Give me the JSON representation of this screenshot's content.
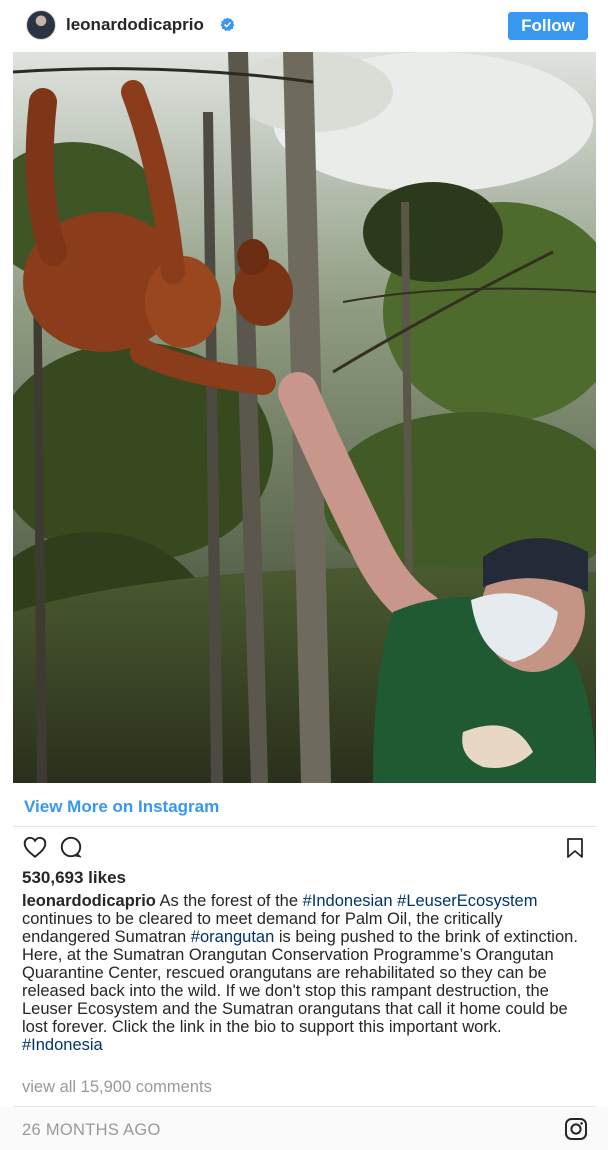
{
  "header": {
    "username": "leonardodicaprio",
    "follow_label": "Follow"
  },
  "photo": {
    "description_icon": "photo-orangutan-forest"
  },
  "view_more_label": "View More on Instagram",
  "actions": {
    "like_icon": "heart-icon",
    "comment_icon": "comment-icon",
    "save_icon": "bookmark-icon"
  },
  "likes": "530,693 likes",
  "caption": {
    "username": "leonardodicaprio",
    "seg1": " As the forest of the ",
    "tag1": "#Indonesian",
    "seg2": " ",
    "tag2": "#LeuserEcosystem",
    "seg3": " continues to be cleared to meet demand for Palm Oil, the critically endangered Sumatran ",
    "tag3": "#orangutan",
    "seg4": " is being pushed to the brink of extinction. Here, at the Sumatran Orangutan Conservation Programme’s Orangutan Quarantine Center, rescued orangutans are rehabilitated so they can be released back into the wild. If we don't stop this rampant destruction, the Leuser Ecosystem and the Sumatran orangutans that call it home could be lost forever. Click the link in the bio to support this important work. ",
    "tag4": "#Indonesia"
  },
  "comments_label": "view all 15,900 comments",
  "timestamp": "26 MONTHS AGO",
  "colors": {
    "accent": "#3897f0",
    "hashtag": "#003569",
    "muted": "#999999"
  }
}
